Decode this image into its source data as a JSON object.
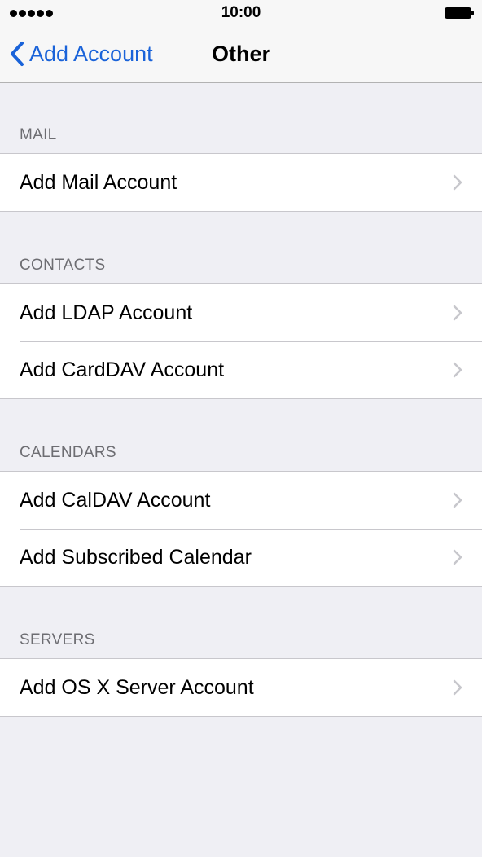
{
  "status_bar": {
    "time": "10:00",
    "signal_icon": "signal-dots-icon",
    "battery_icon": "battery-full-icon"
  },
  "nav": {
    "back_label": "Add Account",
    "back_icon": "chevron-left-icon",
    "title": "Other",
    "accent_color": "#1a63d9"
  },
  "sections": [
    {
      "header": "MAIL",
      "items": [
        "Add Mail Account"
      ]
    },
    {
      "header": "CONTACTS",
      "items": [
        "Add LDAP Account",
        "Add CardDAV Account"
      ]
    },
    {
      "header": "CALENDARS",
      "items": [
        "Add CalDAV Account",
        "Add Subscribed Calendar"
      ]
    },
    {
      "header": "SERVERS",
      "items": [
        "Add OS X Server Account"
      ]
    }
  ],
  "row_icon": "chevron-right-icon",
  "colors": {
    "background": "#efeff4",
    "section_header_text": "#6d6d72",
    "separator": "#c8c7cc",
    "chevron": "#c7c7cc"
  }
}
